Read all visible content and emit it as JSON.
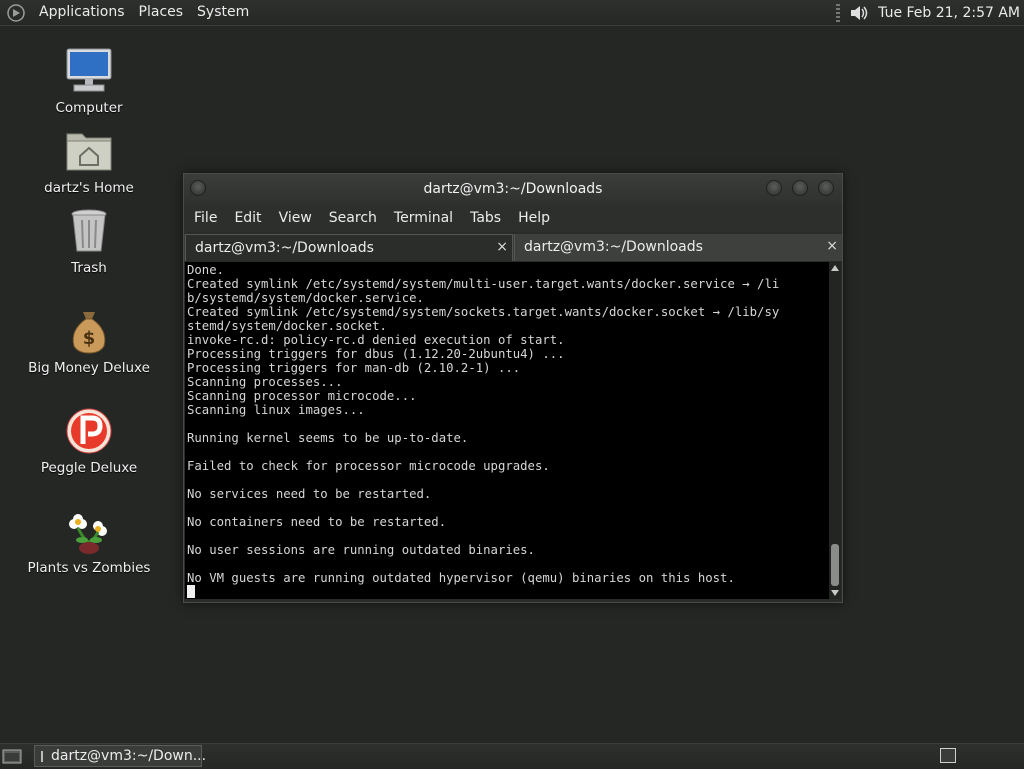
{
  "top_panel": {
    "menus": [
      "Applications",
      "Places",
      "System"
    ],
    "clock": "Tue Feb 21,  2:57 AM",
    "menu_logo_icon": "gnome-foot-icon",
    "volume_icon": "speaker-volume-icon"
  },
  "desktop": {
    "icons": [
      {
        "label": "Computer",
        "icon": "computer-monitor-icon"
      },
      {
        "label": "dartz's Home",
        "icon": "home-folder-icon"
      },
      {
        "label": "Trash",
        "icon": "trash-can-icon"
      },
      {
        "label": "Big Money Deluxe",
        "icon": "money-bag-icon"
      },
      {
        "label": "Peggle Deluxe",
        "icon": "peggle-ball-icon"
      },
      {
        "label": "Plants vs Zombies",
        "icon": "flower-plant-icon"
      }
    ]
  },
  "terminal": {
    "title": "dartz@vm3:~/Downloads",
    "menu": [
      "File",
      "Edit",
      "View",
      "Search",
      "Terminal",
      "Tabs",
      "Help"
    ],
    "tabs": [
      {
        "label": "dartz@vm3:~/Downloads",
        "close": "×"
      },
      {
        "label": "dartz@vm3:~/Downloads",
        "close": "×"
      }
    ],
    "lines": [
      "Done.",
      "Created symlink /etc/systemd/system/multi-user.target.wants/docker.service → /li",
      "b/systemd/system/docker.service.",
      "Created symlink /etc/systemd/system/sockets.target.wants/docker.socket → /lib/sy",
      "stemd/system/docker.socket.",
      "invoke-rc.d: policy-rc.d denied execution of start.",
      "Processing triggers for dbus (1.12.20-2ubuntu4) ...",
      "Processing triggers for man-db (2.10.2-1) ...",
      "Scanning processes...",
      "Scanning processor microcode...",
      "Scanning linux images...",
      "",
      "Running kernel seems to be up-to-date.",
      "",
      "Failed to check for processor microcode upgrades.",
      "",
      "No services need to be restarted.",
      "",
      "No containers need to be restarted.",
      "",
      "No user sessions are running outdated binaries.",
      "",
      "No VM guests are running outdated hypervisor (qemu) binaries on this host."
    ]
  },
  "taskbar": {
    "task_label": "dartz@vm3:~/Down...",
    "show_desktop_icon": "show-desktop-icon",
    "task_icon": "terminal-icon",
    "workspace_icon": "workspace-switcher-icon"
  }
}
